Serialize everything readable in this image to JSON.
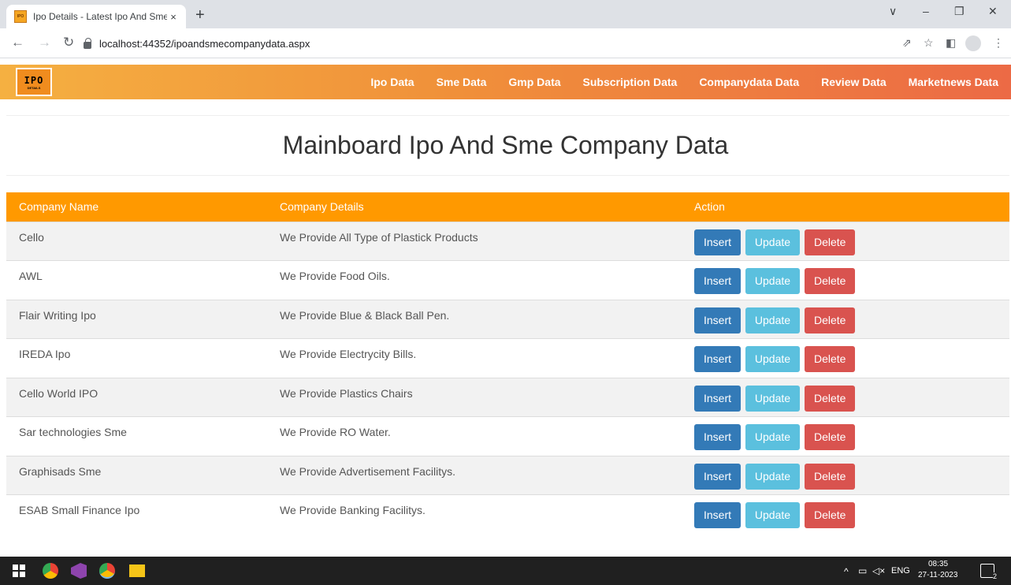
{
  "browser": {
    "tab_title": "Ipo Details - Latest Ipo And Sme",
    "tab_close": "×",
    "new_tab": "+",
    "url": "localhost:44352/ipoandsmecompanydata.aspx",
    "window_controls": [
      "∨",
      "–",
      "❐",
      "✕"
    ]
  },
  "site": {
    "logo_main": "IPO",
    "logo_sub": "DETAILS",
    "nav": [
      "Ipo Data",
      "Sme Data",
      "Gmp Data",
      "Subscription Data",
      "Companydata Data",
      "Review Data",
      "Marketnews Data"
    ]
  },
  "page": {
    "heading": "Mainboard Ipo And Sme Company Data"
  },
  "table": {
    "headers": [
      "Company Name",
      "Company Details",
      "Action"
    ],
    "buttons": {
      "insert": "Insert",
      "update": "Update",
      "delete": "Delete"
    },
    "rows": [
      {
        "name": "Cello",
        "details": "We Provide All Type of Plastick Products"
      },
      {
        "name": "AWL",
        "details": "We Provide Food Oils."
      },
      {
        "name": "Flair Writing Ipo",
        "details": "We Provide Blue & Black Ball Pen."
      },
      {
        "name": "IREDA Ipo",
        "details": "We Provide Electrycity Bills."
      },
      {
        "name": "Cello World IPO",
        "details": "We Provide Plastics Chairs"
      },
      {
        "name": "Sar technologies Sme",
        "details": "We Provide RO Water."
      },
      {
        "name": "Graphisads Sme",
        "details": "We Provide Advertisement Facilitys."
      },
      {
        "name": "ESAB Small Finance Ipo",
        "details": "We Provide Banking Facilitys."
      }
    ]
  },
  "taskbar": {
    "language": "ENG",
    "time": "08:35",
    "date": "27-11-2023",
    "notification_count": "2"
  },
  "colors": {
    "table_header": "#ff9900",
    "insert": "#337ab7",
    "update": "#5bc0de",
    "delete": "#d9534f"
  }
}
